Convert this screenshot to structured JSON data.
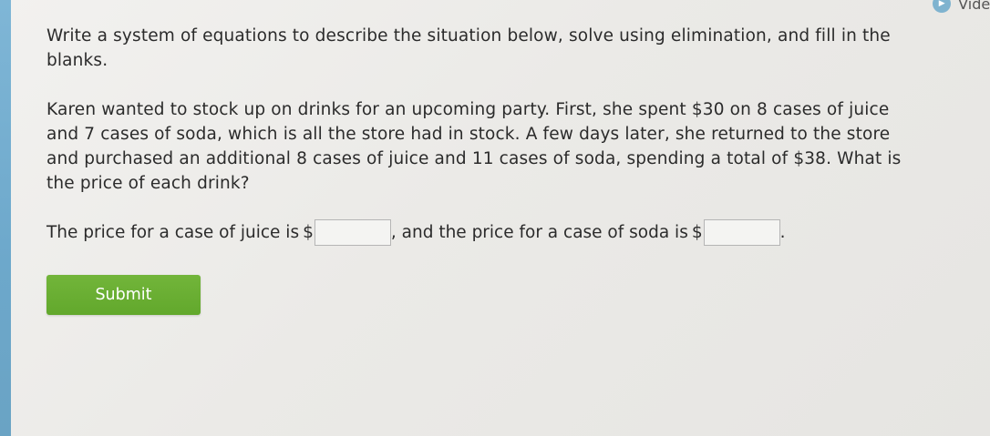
{
  "header": {
    "video_icon": "play-icon",
    "video_label": "Video"
  },
  "question": {
    "instructions": "Write a system of equations to describe the situation below, solve using elimination, and fill in the blanks.",
    "problem": "Karen wanted to stock up on drinks for an upcoming party. First, she spent $30 on 8 cases of juice and 7 cases of soda, which is all the store had in stock. A few days later, she returned to the store and purchased an additional 8 cases of juice and 11 cases of soda, spending a total of $38. What is the price of each drink?"
  },
  "answer": {
    "juice_prefix": "The price for a case of juice is",
    "dollar_sign": "$",
    "juice_value": "",
    "soda_prefix": ", and the price for a case of soda is",
    "soda_value": "",
    "suffix": "."
  },
  "submit": {
    "label": "Submit",
    "color": "#6aaf33"
  },
  "colors": {
    "left_bar": "#7ab0d1",
    "background": "#ecebe8"
  }
}
